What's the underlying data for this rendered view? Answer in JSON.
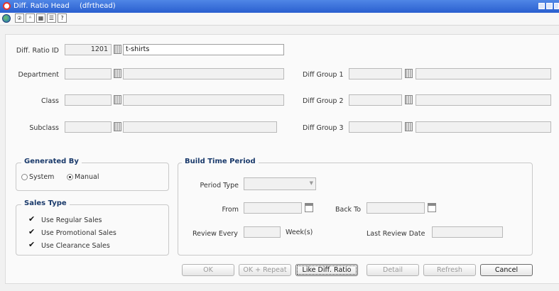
{
  "window": {
    "title": "Diff. Ratio Head",
    "form_code": "(dfrthead)"
  },
  "toolbar": {
    "icons": [
      "globe-icon",
      "help-icon",
      "spell-check-icon",
      "calculator-icon",
      "list-icon",
      "question-icon"
    ],
    "glyphs": [
      "②",
      "ᴬ",
      "▦",
      "☰",
      "?"
    ]
  },
  "form": {
    "diff_ratio_id": {
      "label": "Diff. Ratio ID",
      "value": "1201",
      "description": "t-shirts"
    },
    "department": {
      "label": "Department",
      "value": "",
      "description": ""
    },
    "class": {
      "label": "Class",
      "value": "",
      "description": ""
    },
    "subclass": {
      "label": "Subclass",
      "value": "",
      "description": ""
    },
    "diff_group_1": {
      "label": "Diff Group 1",
      "value": "",
      "description": ""
    },
    "diff_group_2": {
      "label": "Diff Group 2",
      "value": "",
      "description": ""
    },
    "diff_group_3": {
      "label": "Diff Group 3",
      "value": "",
      "description": ""
    }
  },
  "generated_by": {
    "title": "Generated By",
    "options": [
      "System",
      "Manual"
    ],
    "selected": "Manual"
  },
  "sales_type": {
    "title": "Sales Type",
    "checkmark": "✔",
    "items": [
      {
        "label": "Use Regular Sales",
        "checked": true
      },
      {
        "label": "Use Promotional Sales",
        "checked": true
      },
      {
        "label": "Use Clearance Sales",
        "checked": true
      }
    ]
  },
  "build_time_period": {
    "title": "Build Time Period",
    "period_type_label": "Period Type",
    "period_type_value": "",
    "from_label": "From",
    "back_to_label": "Back To",
    "review_every_label": "Review Every",
    "weeks_label": "Week(s)",
    "last_review_date_label": "Last Review Date"
  },
  "buttons": {
    "ok": "OK",
    "ok_repeat": "OK + Repeat",
    "like_diff_ratio": "Like Diff. Ratio",
    "detail": "Detail",
    "refresh": "Refresh",
    "cancel": "Cancel"
  },
  "colors": {
    "titlebar": "#2a5fcf",
    "group_title": "#1a3a6b"
  }
}
